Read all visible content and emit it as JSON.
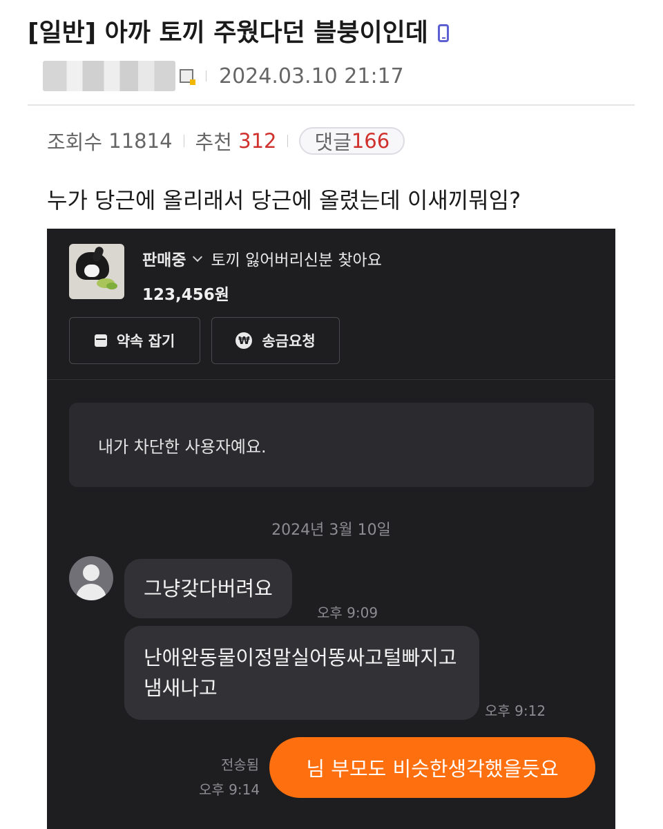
{
  "post": {
    "title": "[일반] 아까 토끼 주웠다던 블붕이인데",
    "date": "2024.03.10 21:17",
    "views_label": "조회수",
    "views": "11814",
    "recommend_label": "추천",
    "recommend": "312",
    "comments_label": "댓글",
    "comments": "166",
    "body": "누가 당근에 올리래서 당근에 올렸는데 이새끼뭐임?"
  },
  "chat": {
    "product": {
      "status": "판매중",
      "title": "토끼 잃어버리신분 찾아요",
      "price": "123,456원"
    },
    "buttons": {
      "appointment": "약속 잡기",
      "transfer": "송금요청"
    },
    "blocked_notice": "내가 차단한 사용자예요.",
    "date_separator": "2024년 3월 10일",
    "messages": [
      {
        "text": "그냥갖다버려요",
        "time": "오후 9:09"
      },
      {
        "text": "난애완동물이정말실어똥싸고털빠지고냄새나고",
        "time": "오후 9:12"
      }
    ],
    "my_message": {
      "text": "님 부모도 비슷한생각했을듯요",
      "status": "전송됨",
      "time": "오후 9:14"
    }
  },
  "colors": {
    "accent_orange": "#fe6f0f",
    "red_count": "#d0312d",
    "phone_icon": "#5b5fd1",
    "chat_background": "#1e1e20"
  },
  "icons": [
    "mobile-phone-icon",
    "member-grade-icon",
    "chevron-down-icon",
    "calendar-icon",
    "won-icon",
    "default-avatar-icon"
  ]
}
